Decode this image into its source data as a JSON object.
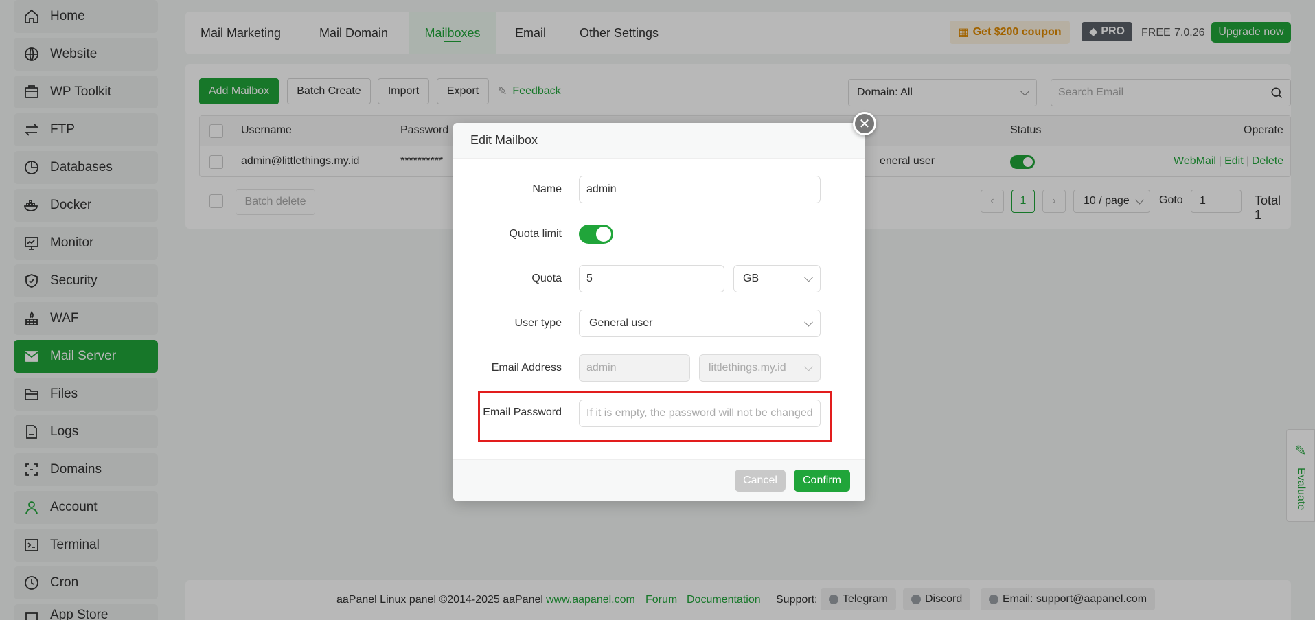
{
  "sidebar": {
    "items": [
      {
        "label": "Home",
        "icon": "home-icon"
      },
      {
        "label": "Website",
        "icon": "globe-icon"
      },
      {
        "label": "WP Toolkit",
        "icon": "toolkit-icon"
      },
      {
        "label": "FTP",
        "icon": "transfer-icon"
      },
      {
        "label": "Databases",
        "icon": "database-icon"
      },
      {
        "label": "Docker",
        "icon": "docker-icon"
      },
      {
        "label": "Monitor",
        "icon": "monitor-icon"
      },
      {
        "label": "Security",
        "icon": "shield-icon"
      },
      {
        "label": "WAF",
        "icon": "firewall-icon"
      },
      {
        "label": "Mail Server",
        "icon": "mail-icon"
      },
      {
        "label": "Files",
        "icon": "folder-icon"
      },
      {
        "label": "Logs",
        "icon": "log-icon"
      },
      {
        "label": "Domains",
        "icon": "domain-icon"
      },
      {
        "label": "Account",
        "icon": "user-icon"
      },
      {
        "label": "Terminal",
        "icon": "terminal-icon"
      },
      {
        "label": "Cron",
        "icon": "clock-icon"
      },
      {
        "label": "App Store",
        "icon": "store-icon"
      }
    ],
    "active_label": "Mail Server"
  },
  "tabs": [
    {
      "label": "Mail Marketing"
    },
    {
      "label": "Mail Domain"
    },
    {
      "label": "Mailboxes"
    },
    {
      "label": "Email"
    },
    {
      "label": "Other Settings"
    }
  ],
  "active_tab": "Mailboxes",
  "header": {
    "coupon": "Get $200 coupon",
    "pro": "PRO",
    "free": "FREE",
    "version": "7.0.26",
    "upgrade": "Upgrade now"
  },
  "toolbar": {
    "add_mailbox": "Add Mailbox",
    "batch_create": "Batch Create",
    "import": "Import",
    "export": "Export",
    "feedback": "Feedback",
    "domain_filter": "Domain: All",
    "search_placeholder": "Search Email"
  },
  "table": {
    "columns": {
      "username": "Username",
      "password": "Password",
      "status": "Status",
      "operate": "Operate"
    },
    "rows": [
      {
        "username": "admin@littlethings.my.id",
        "password": "**********",
        "user_type": "eneral user",
        "status_on": true,
        "ops": [
          "WebMail",
          "Edit",
          "Delete"
        ]
      }
    ]
  },
  "pagination": {
    "batch_delete": "Batch delete",
    "current_page": "1",
    "per_page": "10 / page",
    "goto_label": "Goto",
    "goto_value": "1",
    "total": "Total 1"
  },
  "footer": {
    "copyright": "aaPanel Linux panel ©2014-2025 aaPanel",
    "site_link": "www.aapanel.com",
    "forum": "Forum",
    "documentation": "Documentation",
    "support_label": "Support:",
    "telegram": "Telegram",
    "discord": "Discord",
    "email": "Email: support@aapanel.com"
  },
  "evaluate": "Evaluate",
  "modal": {
    "title": "Edit Mailbox",
    "name_label": "Name",
    "name_value": "admin",
    "quota_limit_label": "Quota limit",
    "quota_limit_on": true,
    "quota_label": "Quota",
    "quota_value": "5",
    "quota_unit": "GB",
    "user_type_label": "User type",
    "user_type_value": "General user",
    "email_address_label": "Email Address",
    "email_local": "admin",
    "email_domain": "littlethings.my.id",
    "email_password_label": "Email Password",
    "email_password_placeholder": "If it is empty, the password will not be changed",
    "cancel": "Cancel",
    "confirm": "Confirm"
  },
  "colors": {
    "accent": "#20a53a",
    "highlight": "#e21d1d"
  }
}
